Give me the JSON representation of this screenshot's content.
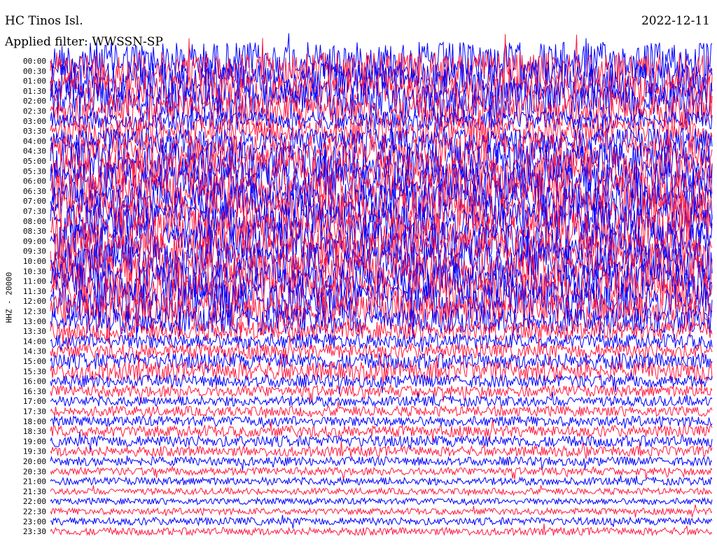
{
  "header": {
    "station": "HC Tinos Isl.",
    "filter": "Applied filter: WWSSN-SP",
    "date": "2022-12-11"
  },
  "chart_data": {
    "type": "line",
    "ylabel": "HHZ - 20000",
    "colors": [
      "#0000ff",
      "#ff1a40"
    ],
    "grid": false,
    "row_labels": [
      "00:00",
      "00:30",
      "01:00",
      "01:30",
      "02:00",
      "02:30",
      "03:00",
      "03:30",
      "04:00",
      "04:30",
      "05:00",
      "05:30",
      "06:00",
      "06:30",
      "07:00",
      "07:30",
      "08:00",
      "08:30",
      "09:00",
      "09:30",
      "10:00",
      "10:30",
      "11:00",
      "11:30",
      "12:00",
      "12:30",
      "13:00",
      "13:30",
      "14:00",
      "14:30",
      "15:00",
      "15:30",
      "16:00",
      "16:30",
      "17:00",
      "17:30",
      "18:00",
      "18:30",
      "19:00",
      "19:30",
      "20:00",
      "20:30",
      "21:00",
      "21:30",
      "22:00",
      "22:30",
      "23:00",
      "23:30"
    ],
    "row_amplitude": [
      3,
      3,
      3,
      2.5,
      3,
      2.5,
      1.5,
      2,
      2,
      2.5,
      3,
      3,
      3,
      3,
      3,
      3,
      3,
      3,
      3,
      3,
      3,
      3,
      3,
      3,
      3,
      2.5,
      2,
      1.5,
      1.2,
      1.2,
      1.3,
      1.5,
      1,
      0.9,
      0.8,
      0.8,
      0.8,
      0.9,
      0.9,
      0.8,
      0.7,
      0.6,
      0.6,
      0.5,
      0.5,
      0.5,
      0.6,
      0.6
    ]
  }
}
